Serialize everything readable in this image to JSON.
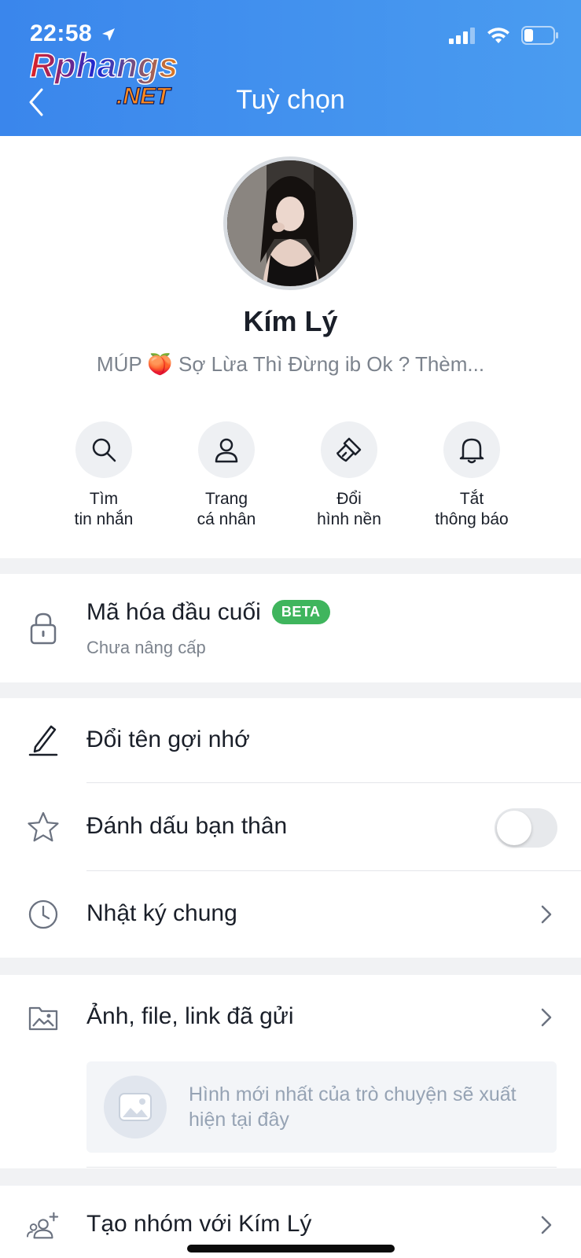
{
  "status_bar": {
    "time": "22:58"
  },
  "watermark": {
    "line1": "Rphangs",
    "line2": ".NET"
  },
  "header": {
    "title": "Tuỳ chọn"
  },
  "profile": {
    "name": "Kím Lý",
    "status": "MÚP 🍑  Sợ Lừa Thì Đừng ib Ok ? Thèm..."
  },
  "actions": [
    {
      "label": "Tìm\ntin nhắn",
      "icon": "search-icon"
    },
    {
      "label": "Trang\ncá nhân",
      "icon": "person-icon"
    },
    {
      "label": "Đổi\nhình nền",
      "icon": "paintbrush-icon"
    },
    {
      "label": "Tắt\nthông báo",
      "icon": "bell-icon"
    }
  ],
  "encryption": {
    "title": "Mã hóa đầu cuối",
    "badge": "BETA",
    "subtitle": "Chưa nâng cấp",
    "icon": "lock-icon"
  },
  "menu": {
    "rename": {
      "label": "Đổi tên gợi nhớ",
      "icon": "pencil-icon"
    },
    "close_friend": {
      "label": "Đánh dấu bạn thân",
      "icon": "star-icon",
      "enabled": false
    },
    "shared_journal": {
      "label": "Nhật ký chung",
      "icon": "clock-icon"
    },
    "media": {
      "label": "Ảnh, file, link đã gửi",
      "icon": "image-folder-icon",
      "placeholder": "Hình mới nhất của trò chuyện sẽ xuất hiện tại đây"
    },
    "create_group": {
      "label": "Tạo nhóm với Kím Lý",
      "icon": "group-add-icon"
    }
  },
  "colors": {
    "header": "#3a86ec",
    "beta": "#3fb55d",
    "text": "#1a1f29",
    "muted": "#7c838d"
  }
}
